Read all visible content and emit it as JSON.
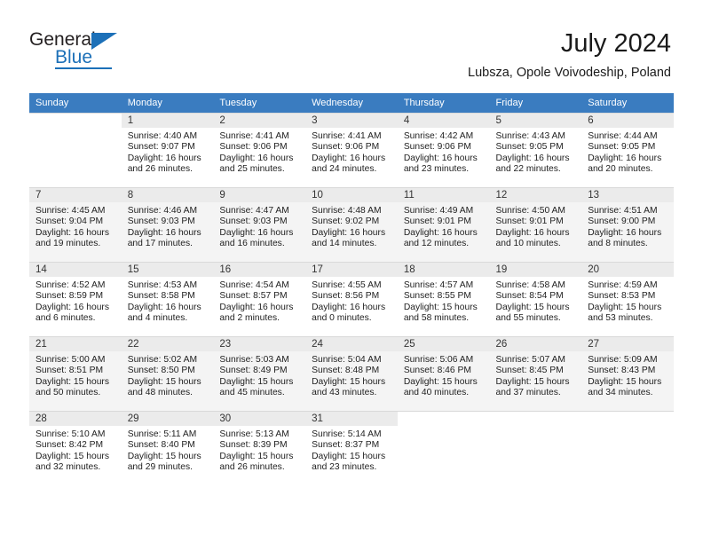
{
  "brand": {
    "name_part1": "General",
    "name_part2": "Blue",
    "accent_color": "#1c70b8"
  },
  "header": {
    "title": "July 2024",
    "subtitle": "Lubsza, Opole Voivodeship, Poland"
  },
  "calendar": {
    "header_color": "#3a7cc0",
    "weekdays": [
      "Sunday",
      "Monday",
      "Tuesday",
      "Wednesday",
      "Thursday",
      "Friday",
      "Saturday"
    ],
    "labels": {
      "sunrise": "Sunrise:",
      "sunset": "Sunset:",
      "daylight": "Daylight:"
    },
    "weeks": [
      {
        "shaded": false,
        "days": [
          {
            "date": "",
            "sunrise": "",
            "sunset": "",
            "daylight_line1": "",
            "daylight_line2": ""
          },
          {
            "date": "1",
            "sunrise": "Sunrise: 4:40 AM",
            "sunset": "Sunset: 9:07 PM",
            "daylight_line1": "Daylight: 16 hours",
            "daylight_line2": "and 26 minutes."
          },
          {
            "date": "2",
            "sunrise": "Sunrise: 4:41 AM",
            "sunset": "Sunset: 9:06 PM",
            "daylight_line1": "Daylight: 16 hours",
            "daylight_line2": "and 25 minutes."
          },
          {
            "date": "3",
            "sunrise": "Sunrise: 4:41 AM",
            "sunset": "Sunset: 9:06 PM",
            "daylight_line1": "Daylight: 16 hours",
            "daylight_line2": "and 24 minutes."
          },
          {
            "date": "4",
            "sunrise": "Sunrise: 4:42 AM",
            "sunset": "Sunset: 9:06 PM",
            "daylight_line1": "Daylight: 16 hours",
            "daylight_line2": "and 23 minutes."
          },
          {
            "date": "5",
            "sunrise": "Sunrise: 4:43 AM",
            "sunset": "Sunset: 9:05 PM",
            "daylight_line1": "Daylight: 16 hours",
            "daylight_line2": "and 22 minutes."
          },
          {
            "date": "6",
            "sunrise": "Sunrise: 4:44 AM",
            "sunset": "Sunset: 9:05 PM",
            "daylight_line1": "Daylight: 16 hours",
            "daylight_line2": "and 20 minutes."
          }
        ]
      },
      {
        "shaded": true,
        "days": [
          {
            "date": "7",
            "sunrise": "Sunrise: 4:45 AM",
            "sunset": "Sunset: 9:04 PM",
            "daylight_line1": "Daylight: 16 hours",
            "daylight_line2": "and 19 minutes."
          },
          {
            "date": "8",
            "sunrise": "Sunrise: 4:46 AM",
            "sunset": "Sunset: 9:03 PM",
            "daylight_line1": "Daylight: 16 hours",
            "daylight_line2": "and 17 minutes."
          },
          {
            "date": "9",
            "sunrise": "Sunrise: 4:47 AM",
            "sunset": "Sunset: 9:03 PM",
            "daylight_line1": "Daylight: 16 hours",
            "daylight_line2": "and 16 minutes."
          },
          {
            "date": "10",
            "sunrise": "Sunrise: 4:48 AM",
            "sunset": "Sunset: 9:02 PM",
            "daylight_line1": "Daylight: 16 hours",
            "daylight_line2": "and 14 minutes."
          },
          {
            "date": "11",
            "sunrise": "Sunrise: 4:49 AM",
            "sunset": "Sunset: 9:01 PM",
            "daylight_line1": "Daylight: 16 hours",
            "daylight_line2": "and 12 minutes."
          },
          {
            "date": "12",
            "sunrise": "Sunrise: 4:50 AM",
            "sunset": "Sunset: 9:01 PM",
            "daylight_line1": "Daylight: 16 hours",
            "daylight_line2": "and 10 minutes."
          },
          {
            "date": "13",
            "sunrise": "Sunrise: 4:51 AM",
            "sunset": "Sunset: 9:00 PM",
            "daylight_line1": "Daylight: 16 hours",
            "daylight_line2": "and 8 minutes."
          }
        ]
      },
      {
        "shaded": false,
        "days": [
          {
            "date": "14",
            "sunrise": "Sunrise: 4:52 AM",
            "sunset": "Sunset: 8:59 PM",
            "daylight_line1": "Daylight: 16 hours",
            "daylight_line2": "and 6 minutes."
          },
          {
            "date": "15",
            "sunrise": "Sunrise: 4:53 AM",
            "sunset": "Sunset: 8:58 PM",
            "daylight_line1": "Daylight: 16 hours",
            "daylight_line2": "and 4 minutes."
          },
          {
            "date": "16",
            "sunrise": "Sunrise: 4:54 AM",
            "sunset": "Sunset: 8:57 PM",
            "daylight_line1": "Daylight: 16 hours",
            "daylight_line2": "and 2 minutes."
          },
          {
            "date": "17",
            "sunrise": "Sunrise: 4:55 AM",
            "sunset": "Sunset: 8:56 PM",
            "daylight_line1": "Daylight: 16 hours",
            "daylight_line2": "and 0 minutes."
          },
          {
            "date": "18",
            "sunrise": "Sunrise: 4:57 AM",
            "sunset": "Sunset: 8:55 PM",
            "daylight_line1": "Daylight: 15 hours",
            "daylight_line2": "and 58 minutes."
          },
          {
            "date": "19",
            "sunrise": "Sunrise: 4:58 AM",
            "sunset": "Sunset: 8:54 PM",
            "daylight_line1": "Daylight: 15 hours",
            "daylight_line2": "and 55 minutes."
          },
          {
            "date": "20",
            "sunrise": "Sunrise: 4:59 AM",
            "sunset": "Sunset: 8:53 PM",
            "daylight_line1": "Daylight: 15 hours",
            "daylight_line2": "and 53 minutes."
          }
        ]
      },
      {
        "shaded": true,
        "days": [
          {
            "date": "21",
            "sunrise": "Sunrise: 5:00 AM",
            "sunset": "Sunset: 8:51 PM",
            "daylight_line1": "Daylight: 15 hours",
            "daylight_line2": "and 50 minutes."
          },
          {
            "date": "22",
            "sunrise": "Sunrise: 5:02 AM",
            "sunset": "Sunset: 8:50 PM",
            "daylight_line1": "Daylight: 15 hours",
            "daylight_line2": "and 48 minutes."
          },
          {
            "date": "23",
            "sunrise": "Sunrise: 5:03 AM",
            "sunset": "Sunset: 8:49 PM",
            "daylight_line1": "Daylight: 15 hours",
            "daylight_line2": "and 45 minutes."
          },
          {
            "date": "24",
            "sunrise": "Sunrise: 5:04 AM",
            "sunset": "Sunset: 8:48 PM",
            "daylight_line1": "Daylight: 15 hours",
            "daylight_line2": "and 43 minutes."
          },
          {
            "date": "25",
            "sunrise": "Sunrise: 5:06 AM",
            "sunset": "Sunset: 8:46 PM",
            "daylight_line1": "Daylight: 15 hours",
            "daylight_line2": "and 40 minutes."
          },
          {
            "date": "26",
            "sunrise": "Sunrise: 5:07 AM",
            "sunset": "Sunset: 8:45 PM",
            "daylight_line1": "Daylight: 15 hours",
            "daylight_line2": "and 37 minutes."
          },
          {
            "date": "27",
            "sunrise": "Sunrise: 5:09 AM",
            "sunset": "Sunset: 8:43 PM",
            "daylight_line1": "Daylight: 15 hours",
            "daylight_line2": "and 34 minutes."
          }
        ]
      },
      {
        "shaded": false,
        "days": [
          {
            "date": "28",
            "sunrise": "Sunrise: 5:10 AM",
            "sunset": "Sunset: 8:42 PM",
            "daylight_line1": "Daylight: 15 hours",
            "daylight_line2": "and 32 minutes."
          },
          {
            "date": "29",
            "sunrise": "Sunrise: 5:11 AM",
            "sunset": "Sunset: 8:40 PM",
            "daylight_line1": "Daylight: 15 hours",
            "daylight_line2": "and 29 minutes."
          },
          {
            "date": "30",
            "sunrise": "Sunrise: 5:13 AM",
            "sunset": "Sunset: 8:39 PM",
            "daylight_line1": "Daylight: 15 hours",
            "daylight_line2": "and 26 minutes."
          },
          {
            "date": "31",
            "sunrise": "Sunrise: 5:14 AM",
            "sunset": "Sunset: 8:37 PM",
            "daylight_line1": "Daylight: 15 hours",
            "daylight_line2": "and 23 minutes."
          },
          {
            "date": "",
            "sunrise": "",
            "sunset": "",
            "daylight_line1": "",
            "daylight_line2": ""
          },
          {
            "date": "",
            "sunrise": "",
            "sunset": "",
            "daylight_line1": "",
            "daylight_line2": ""
          },
          {
            "date": "",
            "sunrise": "",
            "sunset": "",
            "daylight_line1": "",
            "daylight_line2": ""
          }
        ]
      }
    ]
  }
}
